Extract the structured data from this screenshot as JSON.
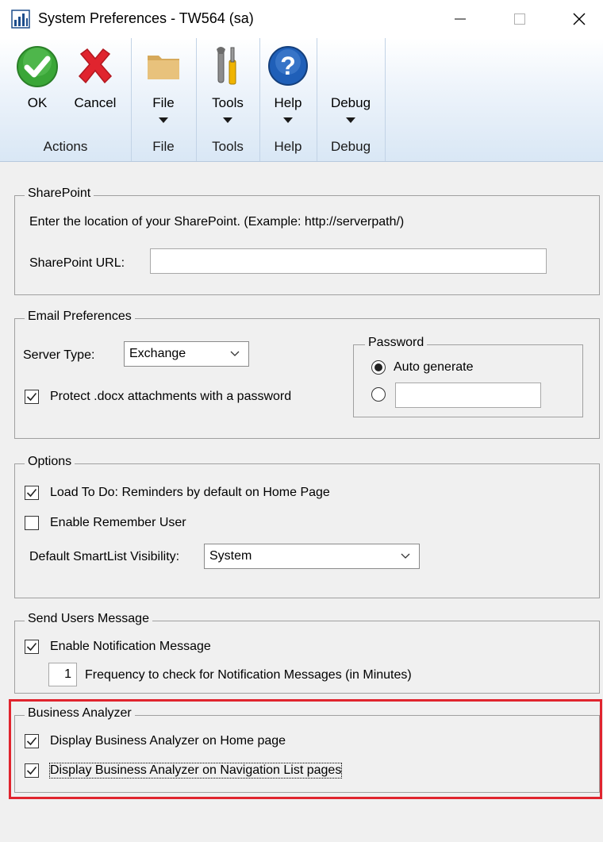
{
  "window": {
    "title": "System Preferences  -  TW564 (sa)",
    "minimize_glyph": "—",
    "maximize_glyph": "☐",
    "close_glyph": "✕"
  },
  "ribbon": {
    "groups": [
      {
        "label": "Actions",
        "buttons": [
          {
            "label": "OK",
            "icon": "checkmark-icon"
          },
          {
            "label": "Cancel",
            "icon": "cancel-x-icon"
          }
        ]
      },
      {
        "label": "File",
        "buttons": [
          {
            "label": "File",
            "icon": "folder-icon"
          }
        ]
      },
      {
        "label": "Tools",
        "buttons": [
          {
            "label": "Tools",
            "icon": "tools-icon"
          }
        ]
      },
      {
        "label": "Help",
        "buttons": [
          {
            "label": "Help",
            "icon": "help-icon"
          }
        ]
      },
      {
        "label": "Debug",
        "buttons": [
          {
            "label": "Debug",
            "icon": ""
          }
        ]
      }
    ]
  },
  "sharepoint": {
    "title": "SharePoint",
    "description": "Enter the location of your SharePoint. (Example: http://serverpath/)",
    "url_label": "SharePoint URL:",
    "url_value": ""
  },
  "email": {
    "title": "Email Preferences",
    "server_type_label": "Server Type:",
    "server_type_value": "Exchange",
    "protect_label": "Protect .docx attachments with a password",
    "protect_checked": true,
    "password": {
      "title": "Password",
      "auto_generate_label": "Auto generate",
      "selected": "auto",
      "custom_value": ""
    }
  },
  "options": {
    "title": "Options",
    "load_todo_label": "Load To Do: Reminders by default on Home Page",
    "load_todo_checked": true,
    "remember_user_label": "Enable Remember User",
    "remember_user_checked": false,
    "smartlist_label": "Default SmartList Visibility:",
    "smartlist_value": "System"
  },
  "send_users_message": {
    "title": "Send Users Message",
    "enable_label": "Enable Notification Message",
    "enable_checked": true,
    "frequency_value": "1",
    "frequency_label": "Frequency to check for Notification Messages (in Minutes)"
  },
  "business_analyzer": {
    "title": "Business Analyzer",
    "home_label": "Display Business Analyzer on Home page",
    "home_checked": true,
    "navlist_label": "Display Business Analyzer on Navigation List pages",
    "navlist_checked": true
  },
  "colors": {
    "highlight": "#e0242e",
    "ok_green": "#3aa637",
    "cancel_red": "#e0242e",
    "help_blue": "#1f5fb8"
  }
}
